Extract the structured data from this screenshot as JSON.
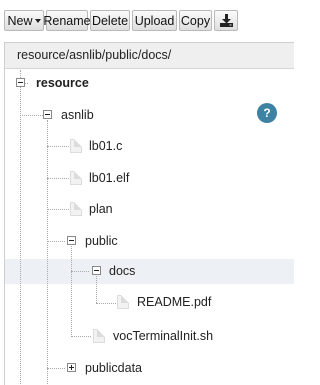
{
  "toolbar": {
    "new_label": "New",
    "rename_label": "Rename",
    "delete_label": "Delete",
    "upload_label": "Upload",
    "copy_label": "Copy",
    "download_icon": "download-icon"
  },
  "path": "resource/asnlib/public/docs/",
  "help_label": "?",
  "tree": {
    "resource": "resource",
    "asnlib": "asnlib",
    "lb01c": "lb01.c",
    "lb01elf": "lb01.elf",
    "plan": "plan",
    "public": "public",
    "docs": "docs",
    "readme": "README.pdf",
    "voc": "vocTerminalInit.sh",
    "publicdata": "publicdata"
  },
  "colors": {
    "help_badge": "#3d82a3",
    "selected_row": "#edf0f4"
  }
}
